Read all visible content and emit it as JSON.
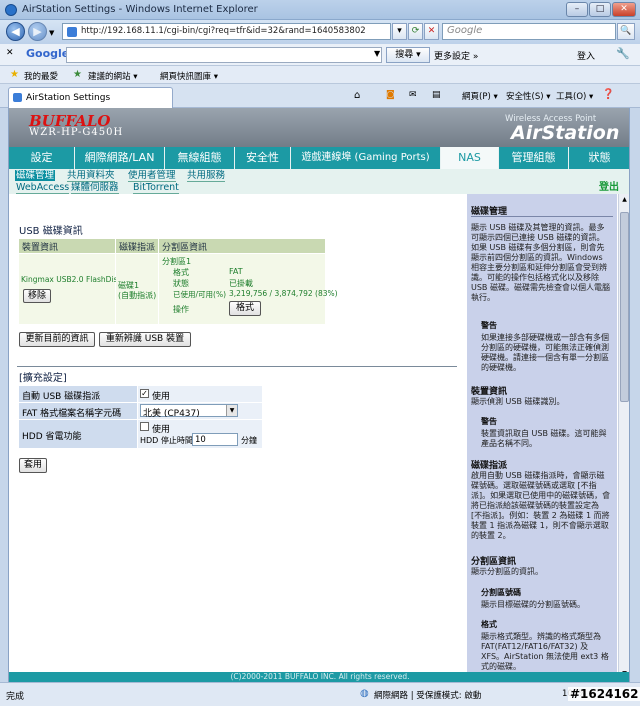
{
  "window": {
    "title": "AirStation Settings - Windows Internet Explorer"
  },
  "browser": {
    "address": "http://192.168.11.1/cgi-bin/cgi?req=tfr&id=32&rand=1640583802",
    "search_placeholder": "Google",
    "google_label": "Google",
    "search_btn": "搜尋 ▾",
    "more_label": "更多設定 »",
    "signin": "登入",
    "fav_label": "我的最愛",
    "fav_items": [
      "建議的網站 ▾",
      "網頁快訊圖庫 ▾"
    ],
    "tab_title": "AirStation Settings",
    "cmd": [
      "網頁(P) ▾",
      "安全性(S) ▾",
      "工具(O) ▾"
    ]
  },
  "header": {
    "brand": "BUFFALO",
    "model": "WZR-HP-G450H",
    "tagline": "Wireless Access Point",
    "product": "AirStation"
  },
  "main_tabs": [
    "設定",
    "網際網路/LAN",
    "無線組態",
    "安全性",
    "遊戲連線埠 (Gaming Ports)",
    "NAS",
    "管理組態",
    "狀態"
  ],
  "sub_tabs": [
    "磁碟管理",
    "共用資料夾",
    "使用者管理",
    "共用服務",
    "WebAccess",
    "媒體伺服器",
    "BitTorrent"
  ],
  "logout": "登出",
  "usb": {
    "title": "USB 磁碟資訊",
    "col1": "裝置資訊",
    "col2": "磁碟指派",
    "col3": "分割區資訊",
    "device": "Kingmax USB2.0 FlashDisk",
    "remove_btn": "移除",
    "assign_line1": "磁碟1",
    "assign_line2": "(自動指派)",
    "partition": "分割區1",
    "k_format": "格式",
    "v_format": "FAT",
    "k_status": "狀態",
    "v_status": "已掛載",
    "k_used": "已使用/可用(%)",
    "v_used": "3,219,756 / 3,874,792 (83%)",
    "k_op": "操作",
    "format_btn": "格式",
    "refresh_btn": "更新目前的資訊",
    "rescan_btn": "重新辨識 USB 裝置"
  },
  "ext": {
    "title": "[擴充設定]",
    "r1_label": "自動 USB 磁碟指派",
    "r1_val": "使用",
    "r2_label": "FAT 格式檔案名稱字元碼",
    "r2_val": "北美 (CP437)",
    "r3_label": "HDD 省電功能",
    "r3_val": "使用",
    "r3_sub": "HDD 停止時間",
    "r3_num": "10",
    "r3_unit": "分鐘",
    "apply_btn": "套用"
  },
  "footer": "(C)2000-2011 BUFFALO INC. All rights reserved.",
  "side": {
    "h1": "磁碟管理",
    "p1": "顯示 USB 磁碟及其管理的資訊。最多可顯示四個已連接 USB 磁碟的資訊。如果 USB 磁碟有多個分割區，則會先顯示前四個分割區的資訊。Windows 相容主要分割區和延伸分割區會受到辨識。可能的操作包括格式化以及移除 USB 磁碟。磁碟需先檢查會以個人電腦執行。",
    "w1": "警告",
    "w1p": "如果連接多部硬碟機或一部含有多個分割區的硬碟機，可能無法正確偵測硬碟機。請連接一個含有單一分割區的硬碟機。",
    "h2": "裝置資訊",
    "p2": "顯示偵測 USB 磁碟識別。",
    "w2": "警告",
    "w2p": "裝置資訊取自 USB 磁碟。這可能與產品名稱不同。",
    "h3": "磁碟指派",
    "p3": "啟用自動 USB 磁碟指派時，會顯示磁碟號碼。選取磁碟號碼或選取 [不指派]。如果選取已使用中的磁碟號碼，會將已指派給該磁碟號碼的裝置設定為 [不指派]。例如：裝置 2 為磁碟 1 而將裝置 1 指派為磁碟 1，則不會顯示選取的裝置 2。",
    "h4": "分割區資訊",
    "p4": "顯示分割區的資訊。",
    "s1": "分割區號碼",
    "s1p": "顯示目標磁碟的分割區號碼。",
    "s2": "格式",
    "s2p": "顯示格式類型。辨識的格式類型為 FAT(FAT12/FAT16/FAT32) 及 XFS。AirStation 無法使用 ext3 格式的磁碟。"
  },
  "statusbar": {
    "left": "完成",
    "zone": "網際網路 | 受保護模式: 啟動",
    "zoom": "100%"
  },
  "watermark": "#1624162"
}
